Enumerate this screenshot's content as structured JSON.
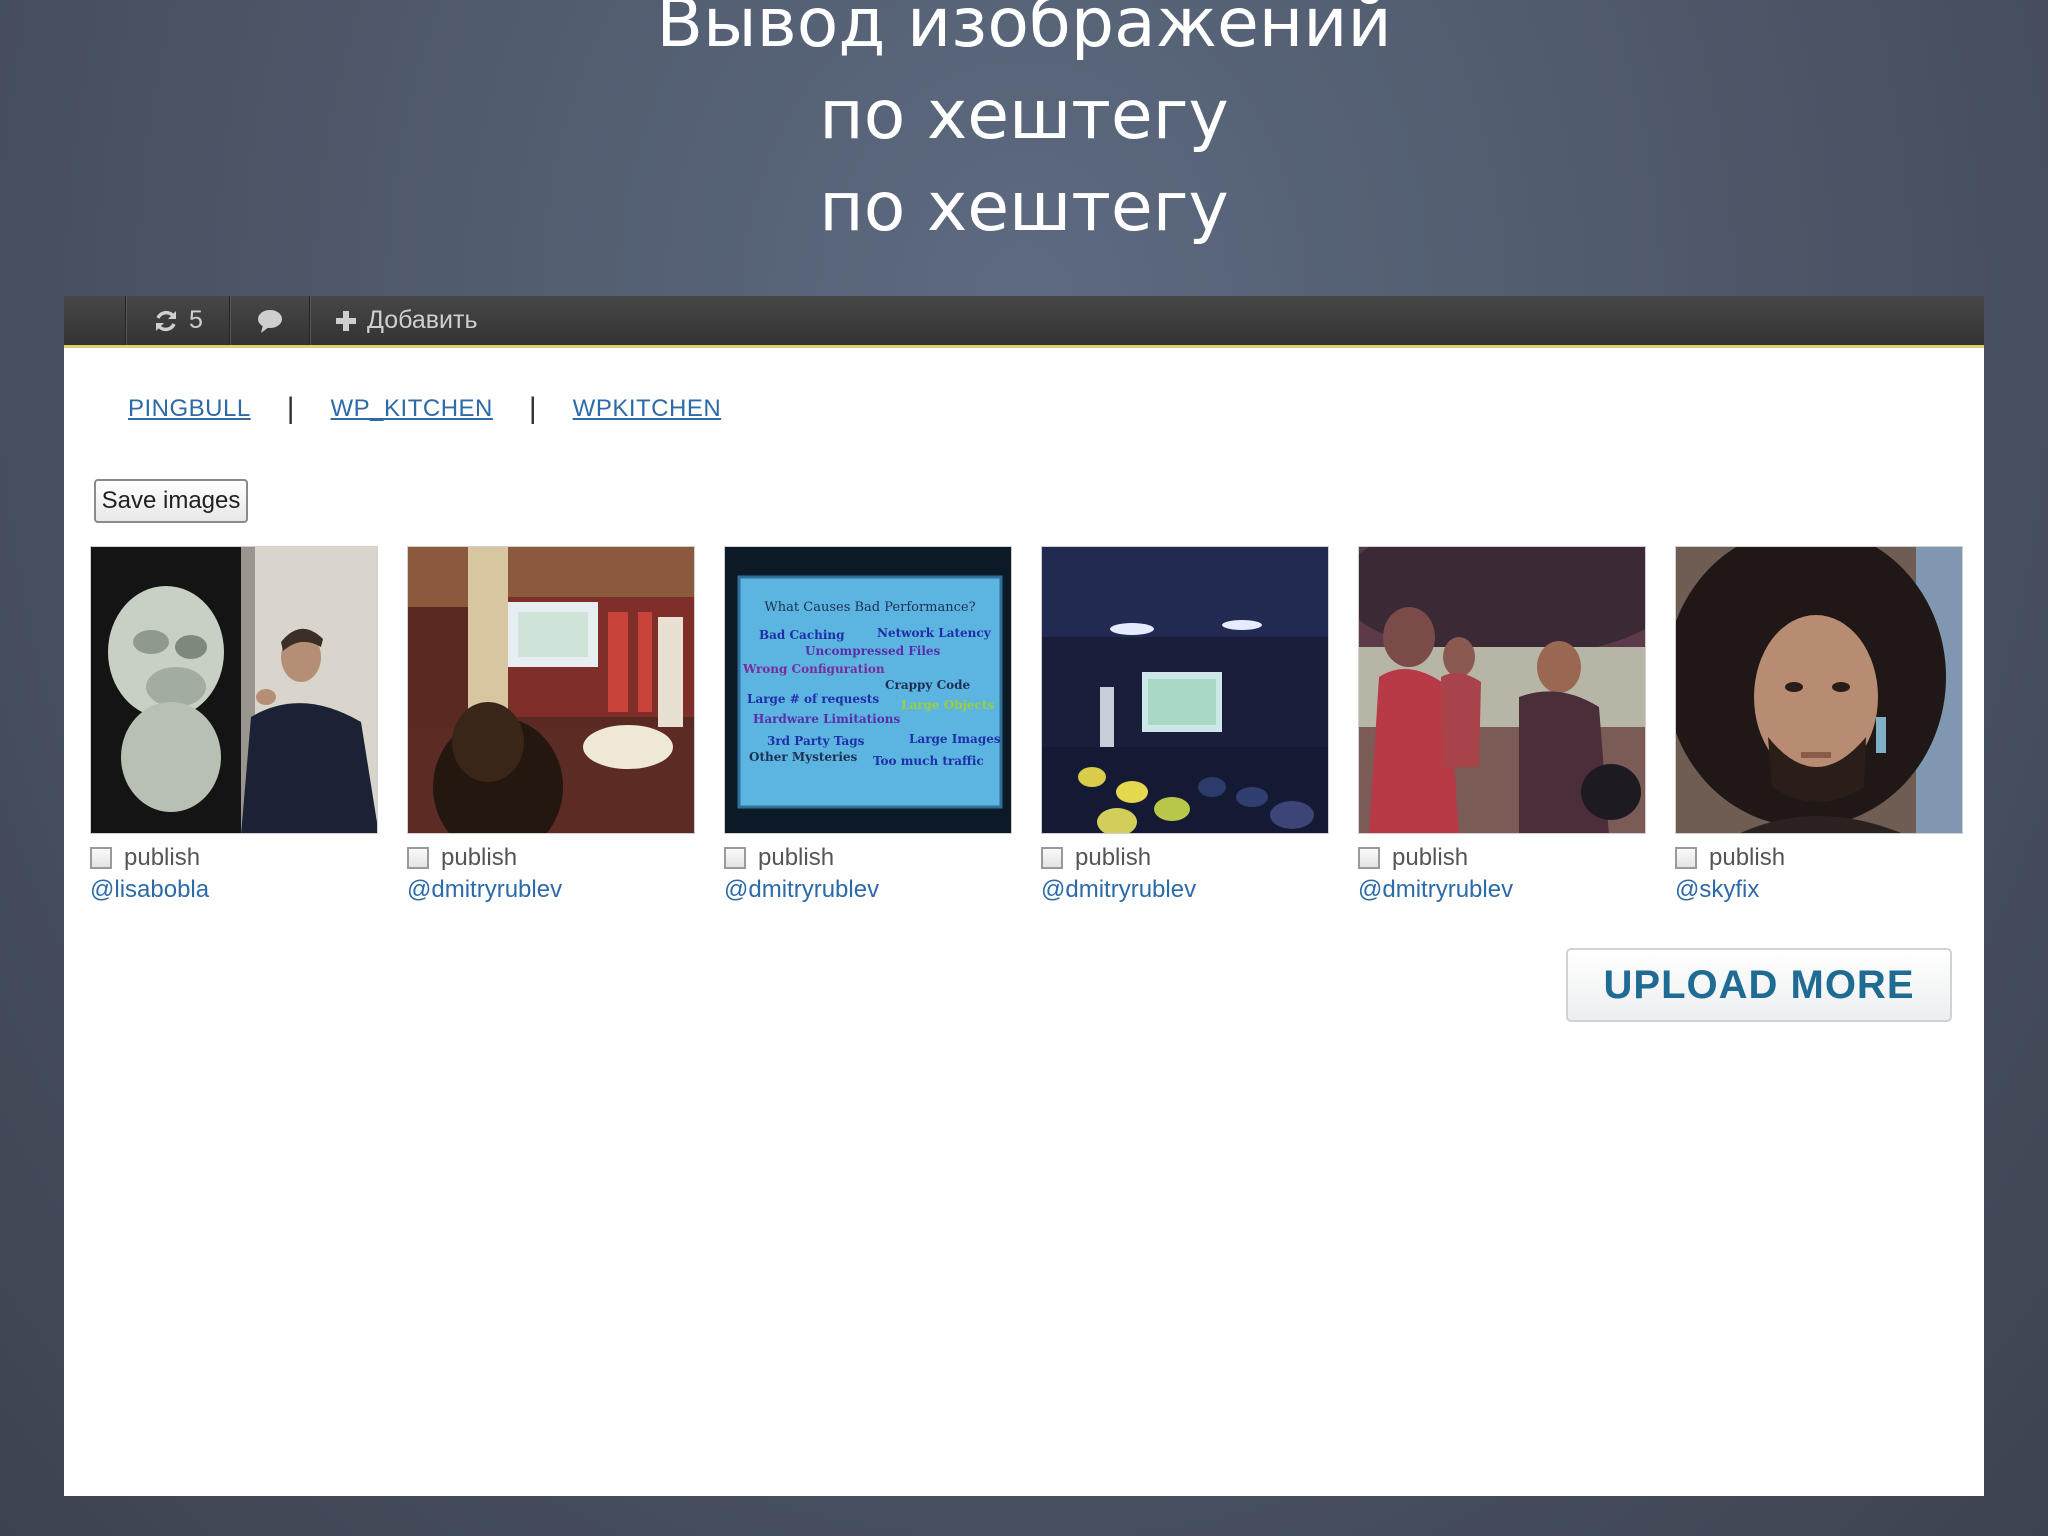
{
  "slide": {
    "title_lines": [
      "Вывод изображений",
      "по хештегу",
      "по хештегу"
    ]
  },
  "admin_bar": {
    "updates_count": "5",
    "new_label": "Добавить"
  },
  "hashtags": [
    "PINGBULL",
    "WP_KITCHEN",
    "WPKITCHEN"
  ],
  "save_button_label": "Save images",
  "images": [
    {
      "publish_label": "publish",
      "username": "@lisabobla"
    },
    {
      "publish_label": "publish",
      "username": "@dmitryrublev"
    },
    {
      "publish_label": "publish",
      "username": "@dmitryrublev"
    },
    {
      "publish_label": "publish",
      "username": "@dmitryrublev"
    },
    {
      "publish_label": "publish",
      "username": "@dmitryrublev"
    },
    {
      "publish_label": "publish",
      "username": "@skyfix"
    }
  ],
  "slide3_text": {
    "title": "What Causes Bad Performance?",
    "items": [
      "Bad Caching",
      "Network Latency",
      "Uncompressed Files",
      "Wrong Configuration",
      "Crappy Code",
      "Large # of requests",
      "Large Objects",
      "Hardware Limitations",
      "3rd Party Tags",
      "Large Images",
      "Other Mysteries",
      "Too much traffic"
    ]
  },
  "upload_more_label": "UPLOAD MORE",
  "colors": {
    "link": "#2d6aa8",
    "upload_text": "#1f6b94",
    "admin_bar": "#3a3a3a",
    "admin_bar_border": "#d9d26e"
  }
}
